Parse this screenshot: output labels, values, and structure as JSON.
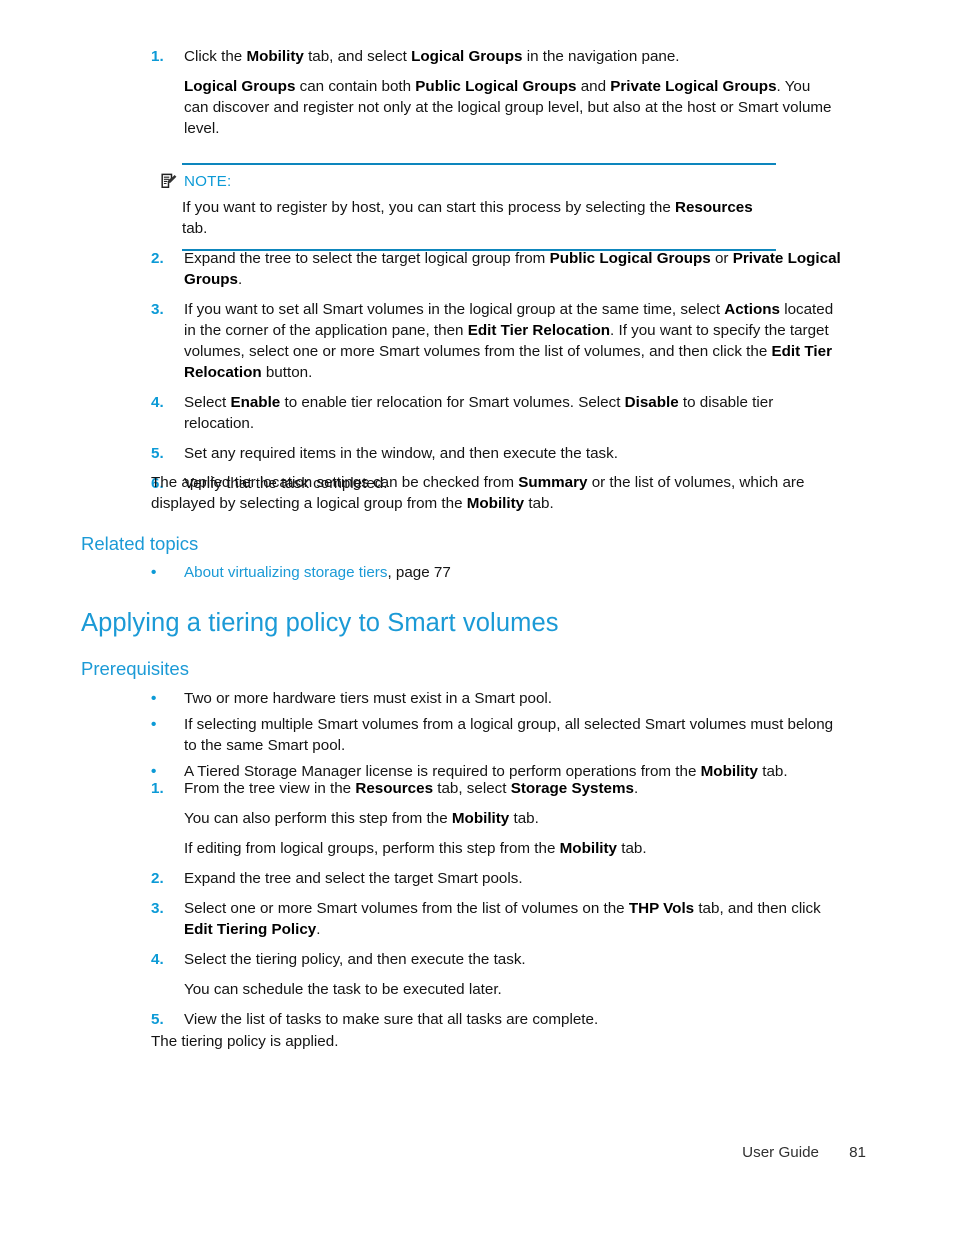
{
  "page": {
    "accent_blue": "#1b9ad6",
    "marker_blue": "#0c9ad6",
    "rule_blue": "#0d86bd",
    "text_color": "#141414"
  },
  "procedure_one": {
    "step1": {
      "number": "1.",
      "line_a_pre": "Click the ",
      "line_a_b1": "Mobility",
      "line_a_mid": " tab, and select ",
      "line_a_b2": "Logical Groups",
      "line_a_post": " in the navigation pane.",
      "line_b_b1": "Logical Groups",
      "line_b_mid1": " can contain both ",
      "line_b_b2": "Public Logical Groups",
      "line_b_mid2": " and ",
      "line_b_b3": "Private Logical Groups",
      "line_b_post": ". You can discover and register not only at the logical group level, but also at the host or Smart volume level."
    }
  },
  "note": {
    "icon": "note-pencil-icon",
    "label": "NOTE:",
    "body_pre": "If you want to register by host, you can start this process by selecting the ",
    "body_bold": "Resources",
    "body_post": " tab."
  },
  "procedure_two": {
    "step2": {
      "number": "2.",
      "pre": "Expand the tree to select the target logical group from ",
      "b1": "Public Logical Groups",
      "mid": " or ",
      "b2": "Private Logical Groups",
      "post": "."
    },
    "step3": {
      "number": "3.",
      "pre": "If you want to set all Smart volumes in the logical group at the same time, select ",
      "b1": "Actions",
      "mid1": " located in the corner of the application pane, then ",
      "b2": "Edit Tier Relocation",
      "mid2": ". If you want to specify the target volumes, select one or more Smart volumes from the list of volumes, and then click the ",
      "b3": "Edit Tier Relocation",
      "post": " button."
    },
    "step4": {
      "number": "4.",
      "pre": "Select ",
      "b1": "Enable",
      "mid": " to enable tier relocation for Smart volumes. Select ",
      "b2": "Disable",
      "post": " to disable tier relocation."
    },
    "step5": {
      "number": "5.",
      "text": "Set any required items in the window, and then execute the task."
    },
    "step6": {
      "number": "6.",
      "text": "Verify that the task completed."
    }
  },
  "trailing_paragraph": {
    "pre": "The applied tier location settings can be checked from ",
    "b1": "Summary",
    "mid": " or the list of volumes, which are displayed by selecting a logical group from the ",
    "b2": "Mobility",
    "post": " tab."
  },
  "related_topics": {
    "heading": "Related topics",
    "items": [
      {
        "link_text": "About virtualizing storage tiers",
        "suffix": ", page 77"
      }
    ]
  },
  "section": {
    "title": "Applying a tiering policy to Smart volumes",
    "subtitle": "Prerequisites"
  },
  "prerequisites": {
    "bullets": [
      {
        "text": "Two or more hardware tiers must exist in a Smart pool."
      },
      {
        "text": "If selecting multiple Smart volumes from a logical group, all selected Smart volumes must belong to the same Smart pool."
      }
    ],
    "bullet3": {
      "pre": "A Tiered Storage Manager license is required to perform operations from the ",
      "b1": "Mobility",
      "post": " tab."
    }
  },
  "procedure_three": {
    "step1": {
      "number": "1.",
      "pre": "From the tree view in the ",
      "b1": "Resources",
      "mid": " tab, select ",
      "b2": "Storage Systems",
      "post": ".",
      "sub_a_pre": "You can also perform this step from the ",
      "sub_a_b": "Mobility",
      "sub_a_post": " tab.",
      "sub_b_pre": "If editing from logical groups, perform this step from the ",
      "sub_b_b": "Mobility",
      "sub_b_post": " tab."
    },
    "step2": {
      "number": "2.",
      "text": "Expand the tree and select the target Smart pools."
    },
    "step3": {
      "number": "3.",
      "pre": "Select one or more Smart volumes from the list of volumes on the ",
      "b1": "THP Vols",
      "mid": " tab, and then click ",
      "b2": "Edit Tiering Policy",
      "post": "."
    },
    "step4": {
      "number": "4.",
      "text": "Select the tiering policy, and then execute the task.",
      "sub": "You can schedule the task to be executed later."
    },
    "step5": {
      "number": "5.",
      "text": "View the list of tasks to make sure that all tasks are complete."
    }
  },
  "final_paragraph": {
    "text": "The tiering policy is applied."
  },
  "footer": {
    "label": "User Guide",
    "page_number": "81"
  }
}
